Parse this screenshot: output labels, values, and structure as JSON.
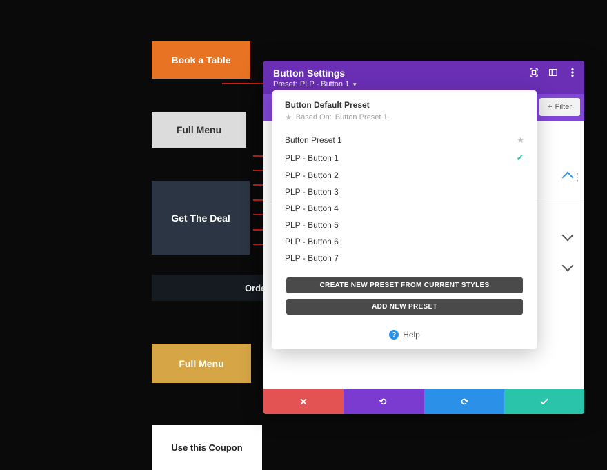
{
  "buttons": {
    "book_table": "Book a Table",
    "full_menu_1": "Full Menu",
    "get_deal": "Get The Deal",
    "order_now": "Order Now",
    "full_menu_2": "Full Menu",
    "use_coupon": "Use this Coupon"
  },
  "modal": {
    "title": "Button Settings",
    "preset_label": "Preset:",
    "preset_value": "PLP - Button 1",
    "filter_label": "Filter"
  },
  "dropdown": {
    "default_title": "Button Default Preset",
    "based_on_prefix": "Based On:",
    "based_on_value": "Button Preset 1",
    "items": [
      {
        "label": "Button Preset 1",
        "star": true
      },
      {
        "label": "PLP - Button 1",
        "checked": true
      },
      {
        "label": "PLP - Button 2"
      },
      {
        "label": "PLP - Button 3"
      },
      {
        "label": "PLP - Button 4"
      },
      {
        "label": "PLP - Button 5"
      },
      {
        "label": "PLP - Button 6"
      },
      {
        "label": "PLP - Button 7"
      }
    ],
    "create_btn": "CREATE NEW PRESET FROM CURRENT STYLES",
    "add_btn": "ADD NEW PRESET",
    "help": "Help"
  },
  "footer": {
    "cancel": "cancel",
    "undo": "undo",
    "redo": "redo",
    "save": "save"
  }
}
